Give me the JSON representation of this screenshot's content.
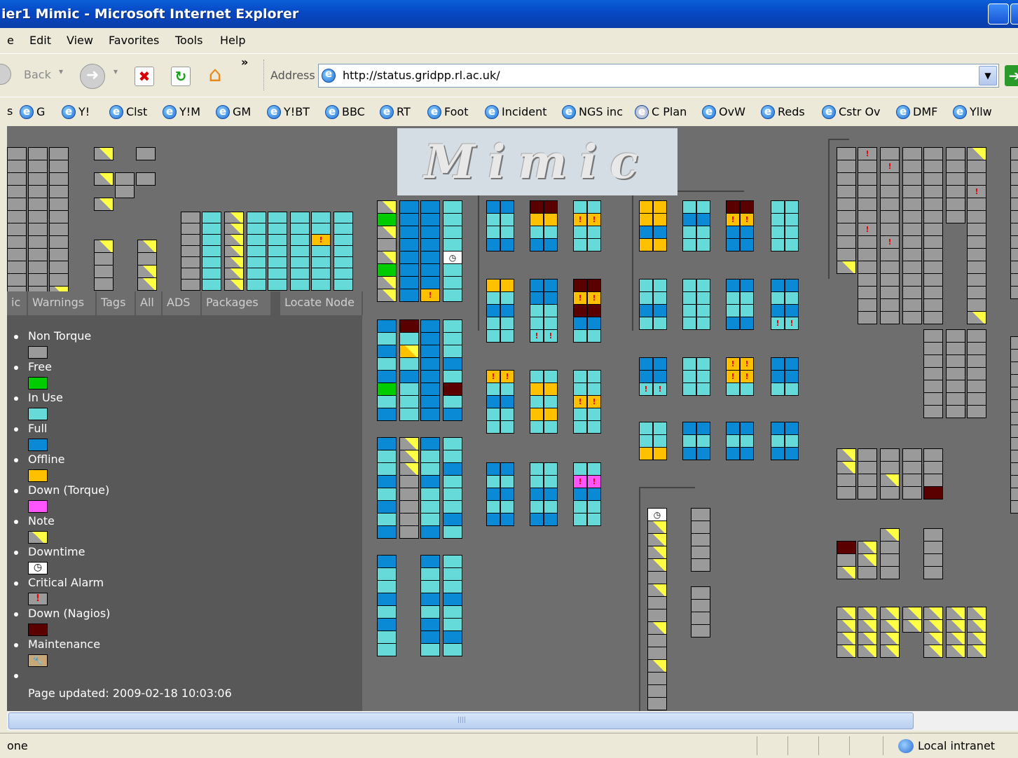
{
  "window": {
    "title": "ier1 Mimic - Microsoft Internet Explorer"
  },
  "menu": [
    "e",
    "Edit",
    "View",
    "Favorites",
    "Tools",
    "Help"
  ],
  "toolbar": {
    "back_label": "Back",
    "chevrons": "»",
    "address_label": "Address",
    "address_value": "http://status.gridpp.rl.ac.uk/"
  },
  "links": [
    "G",
    "Y!",
    "Clst",
    "Y!M",
    "GM",
    "Y!BT",
    "BBC",
    "RT",
    "Foot",
    "Incident",
    "NGS inc",
    "C Plan",
    "OvW",
    "Reds",
    "Cstr Ov",
    "DMF",
    "Yllw"
  ],
  "logo": "Mimic",
  "tabs": [
    "ic",
    "Warnings",
    "Tags",
    "All",
    "ADS",
    "Packages",
    "Locate Node"
  ],
  "legend": [
    {
      "label": "Non Torque",
      "color": "#9a9a9a",
      "kind": "plain"
    },
    {
      "label": "Free",
      "color": "#00cc00",
      "kind": "plain"
    },
    {
      "label": "In Use",
      "color": "#66d9d9",
      "kind": "plain"
    },
    {
      "label": "Full",
      "color": "#0a8ad4",
      "kind": "plain"
    },
    {
      "label": "Offline",
      "color": "#ffc000",
      "kind": "plain"
    },
    {
      "label": "Down (Torque)",
      "color": "#ff55ff",
      "kind": "plain"
    },
    {
      "label": "Note",
      "color": "#9a9a9a",
      "kind": "note"
    },
    {
      "label": "Downtime",
      "color": "#ffffff",
      "kind": "clock"
    },
    {
      "label": "Critical Alarm",
      "color": "#9a9a9a",
      "kind": "alarm"
    },
    {
      "label": "Down (Nagios)",
      "color": "#5a0000",
      "kind": "plain"
    },
    {
      "label": "Maintenance",
      "color": "#c8a878",
      "kind": "wrench"
    }
  ],
  "updated": "Page updated: 2009-02-18 10:03:06",
  "status": {
    "left": "one",
    "zone": "Local intranet"
  },
  "colors": {
    "G": "#9a9a9a",
    "F": "#00cc00",
    "U": "#66d9d9",
    "B": "#0a8ad4",
    "O": "#ffc000",
    "P": "#ff55ff",
    "R": "#5a0000"
  }
}
